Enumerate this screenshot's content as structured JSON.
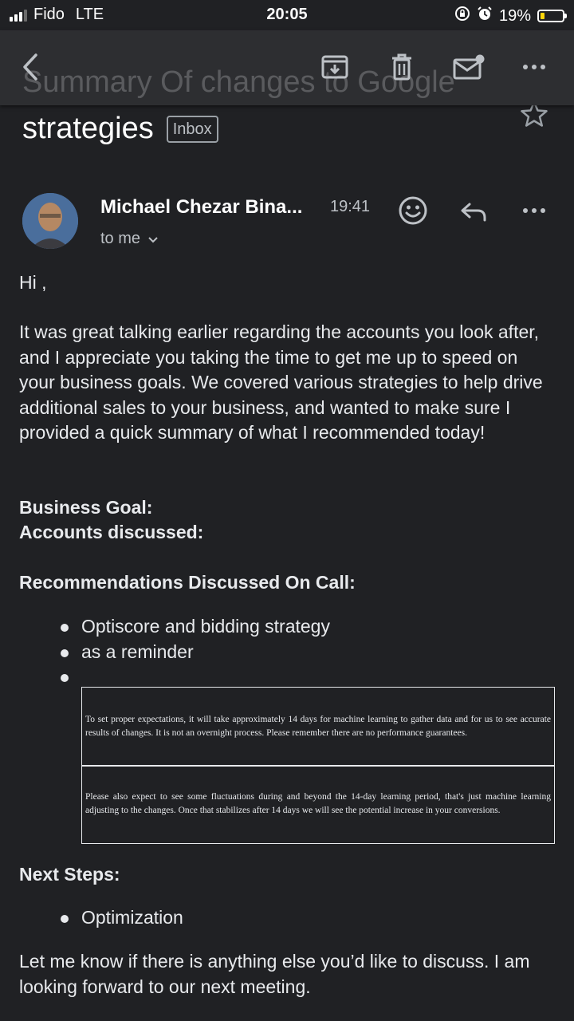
{
  "status_bar": {
    "carrier": "Fido",
    "network": "LTE",
    "time": "20:05",
    "battery": "19%",
    "battery_level": 0.19,
    "battery_color": "#ffd60a"
  },
  "toolbar": {
    "ghost_title": "Summary Of changes to Google",
    "icons": [
      "back-arrow-icon",
      "archive-icon",
      "delete-icon",
      "mark-unread-icon",
      "more-options-icon"
    ]
  },
  "email": {
    "subject": "strategies",
    "label": "Inbox",
    "sender_name": "Michael Chezar Bina...",
    "time": "19:41",
    "recipient": "to me",
    "greeting": "Hi ,",
    "intro": "It was great talking earlier regarding the accounts you look after, and I appreciate you taking the time to get me up to speed on your business goals. We covered various strategies to help drive additional sales to your business, and wanted to make sure I provided a quick summary of what I recommended today!",
    "business_goal": "Business Goal:",
    "accounts_discussed": "Accounts discussed:",
    "recommendations_heading": "Recommendations Discussed On Call:",
    "recommendations": [
      "Optiscore and bidding strategy",
      "as a reminder",
      ""
    ],
    "notes": [
      "To set proper expectations, it will take approximately 14 days for machine learning to gather data and for us to see accurate results of changes. It is not an overnight process. Please remember there are no performance guarantees.",
      "Please also expect to see some fluctuations during and beyond the 14-day learning period, that's just machine learning adjusting to the changes. Once that stabilizes after 14 days we will see the potential increase in your conversions."
    ],
    "next_steps_heading": "Next Steps:",
    "next_steps": [
      "Optimization"
    ],
    "closing": "Let me know if there is anything else you’d like to discuss. I am looking forward to our next meeting."
  },
  "colors": {
    "background": "#202124",
    "toolbar": "#2d2e31",
    "text": "#e8eaed",
    "muted": "#bdc1c6"
  }
}
